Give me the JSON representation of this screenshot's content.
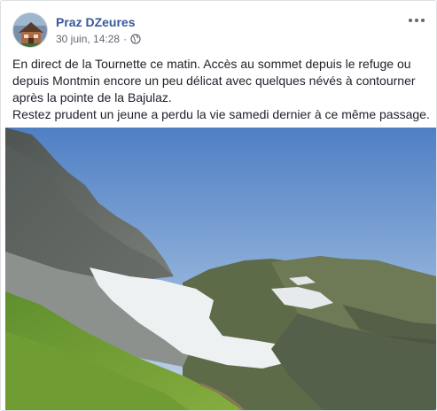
{
  "post": {
    "author": "Praz DZeures",
    "timestamp": "30 juin, 14:28",
    "separator": "·",
    "audience_icon": "globe-icon",
    "more_icon": "more-options-icon",
    "text_lines": [
      "En direct de la Tournette ce matin. Accès au sommet depuis le refuge ou",
      "depuis Montmin encore un peu délicat avec quelques névés à contourner",
      "après la pointe de la Bajulaz.",
      "Restez prudent un jeune a perdu la vie samedi dernier à ce même passage."
    ],
    "photo_description_icon": "mountain-photo"
  },
  "colors": {
    "author_link": "#385898",
    "meta_text": "#616770",
    "body_text": "#1d2129",
    "border": "#dddfe2"
  }
}
